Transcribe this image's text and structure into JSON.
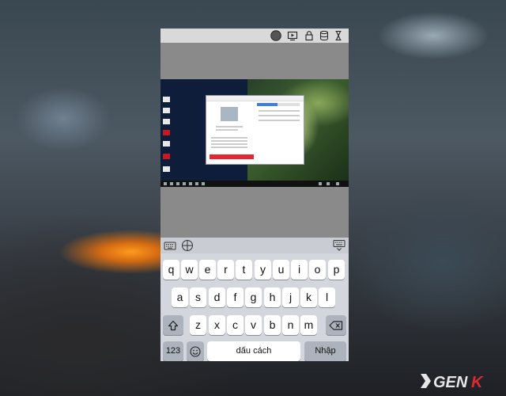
{
  "keyboard": {
    "rows": [
      [
        "q",
        "w",
        "e",
        "r",
        "t",
        "y",
        "u",
        "i",
        "o",
        "p"
      ],
      [
        "a",
        "s",
        "d",
        "f",
        "g",
        "h",
        "j",
        "k",
        "l"
      ],
      [
        "z",
        "x",
        "c",
        "v",
        "b",
        "n",
        "m"
      ]
    ],
    "numbers_key": "123",
    "space_key": "dấu cách",
    "return_key": "Nhập"
  },
  "icons": {
    "topbar": [
      "record-circle-icon",
      "play-screen-icon",
      "lock-icon",
      "database-icon",
      "hourglass-icon"
    ],
    "keyboard_toolbar": [
      "keyboard-icon",
      "crosshair-icon",
      "keyboard-hide-icon"
    ],
    "keys": [
      "shift-icon",
      "emoji-icon",
      "backspace-icon"
    ]
  },
  "colors": {
    "keyboard_bg": "#d3d6dc",
    "key_light": "#ffffff",
    "key_dark": "#adb3bd",
    "topbar": "#d9d9d9",
    "accent_red": "#e3272f",
    "brand_blue": "#3f7fd6"
  }
}
